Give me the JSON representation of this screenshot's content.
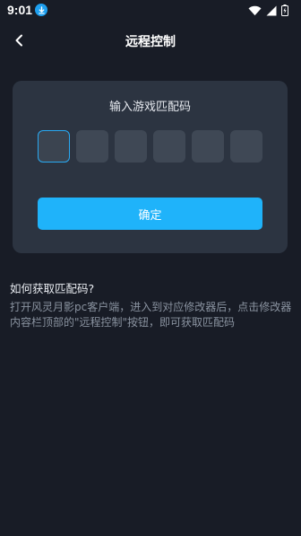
{
  "status_bar": {
    "time": "9:01"
  },
  "header": {
    "title": "远程控制"
  },
  "card": {
    "title": "输入游戏匹配码",
    "confirm_label": "确定",
    "code_boxes": [
      "",
      "",
      "",
      "",
      "",
      ""
    ]
  },
  "help": {
    "title": "如何获取匹配码?",
    "description": "打开风灵月影pc客户端，进入到对应修改器后，点击修改器内容栏顶部的\"远程控制\"按钮，即可获取匹配码"
  },
  "colors": {
    "background": "#181c26",
    "card": "#2c3441",
    "accent": "#1fb3fa",
    "code_box": "#3f4855"
  },
  "icons": {
    "download": "download-icon",
    "wifi": "wifi-icon",
    "signal": "signal-icon",
    "battery": "battery-icon",
    "back": "back-arrow-icon"
  }
}
